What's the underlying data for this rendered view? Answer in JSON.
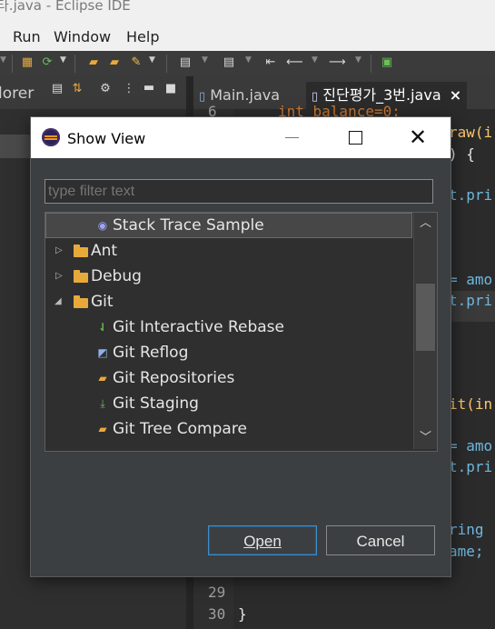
{
  "window": {
    "title": "타.java - Eclipse IDE"
  },
  "menu": [
    "Run",
    "Window",
    "Help"
  ],
  "left_view": {
    "label": "lorer"
  },
  "editor": {
    "tabs": [
      {
        "label": "Main.java",
        "active": false
      },
      {
        "label": "진단평가_3번.java",
        "active": true,
        "close": "×"
      }
    ],
    "line_numbers": [
      "6",
      "29",
      "30"
    ],
    "code": {
      "line6": "int balance=0;",
      "frag1": "raw(i",
      "frag2": ") {",
      "frag3": "t.pri",
      "frag4": "= amo",
      "frag5": "t.pri",
      "frag6": "it(in",
      "frag7": "= amo",
      "frag8": "t.pri",
      "frag9": "ring",
      "frag10": "ame;",
      "line30": "}"
    }
  },
  "dialog": {
    "title": "Show View",
    "filter_placeholder": "type filter text",
    "tree": [
      {
        "label": "Stack Trace Sample",
        "level": 1,
        "icon": "plugin-icon",
        "selected": true
      },
      {
        "label": "Ant",
        "level": 0,
        "icon": "folder-icon",
        "expanded": false
      },
      {
        "label": "Debug",
        "level": 0,
        "icon": "folder-icon",
        "expanded": false
      },
      {
        "label": "Git",
        "level": 0,
        "icon": "folder-icon",
        "expanded": true
      },
      {
        "label": "Git Interactive Rebase",
        "level": 1,
        "icon": "git-rebase-icon"
      },
      {
        "label": "Git Reflog",
        "level": 1,
        "icon": "git-reflog-icon"
      },
      {
        "label": "Git Repositories",
        "level": 1,
        "icon": "git-repositories-icon"
      },
      {
        "label": "Git Staging",
        "level": 1,
        "icon": "git-staging-icon"
      },
      {
        "label": "Git Tree Compare",
        "level": 1,
        "icon": "git-tree-compare-icon"
      }
    ],
    "buttons": {
      "open": "Open",
      "cancel": "Cancel"
    }
  },
  "colors": {
    "dialog_bg": "#3c3f41",
    "accent": "#3f8ec8",
    "folder": "#e8a93b"
  }
}
